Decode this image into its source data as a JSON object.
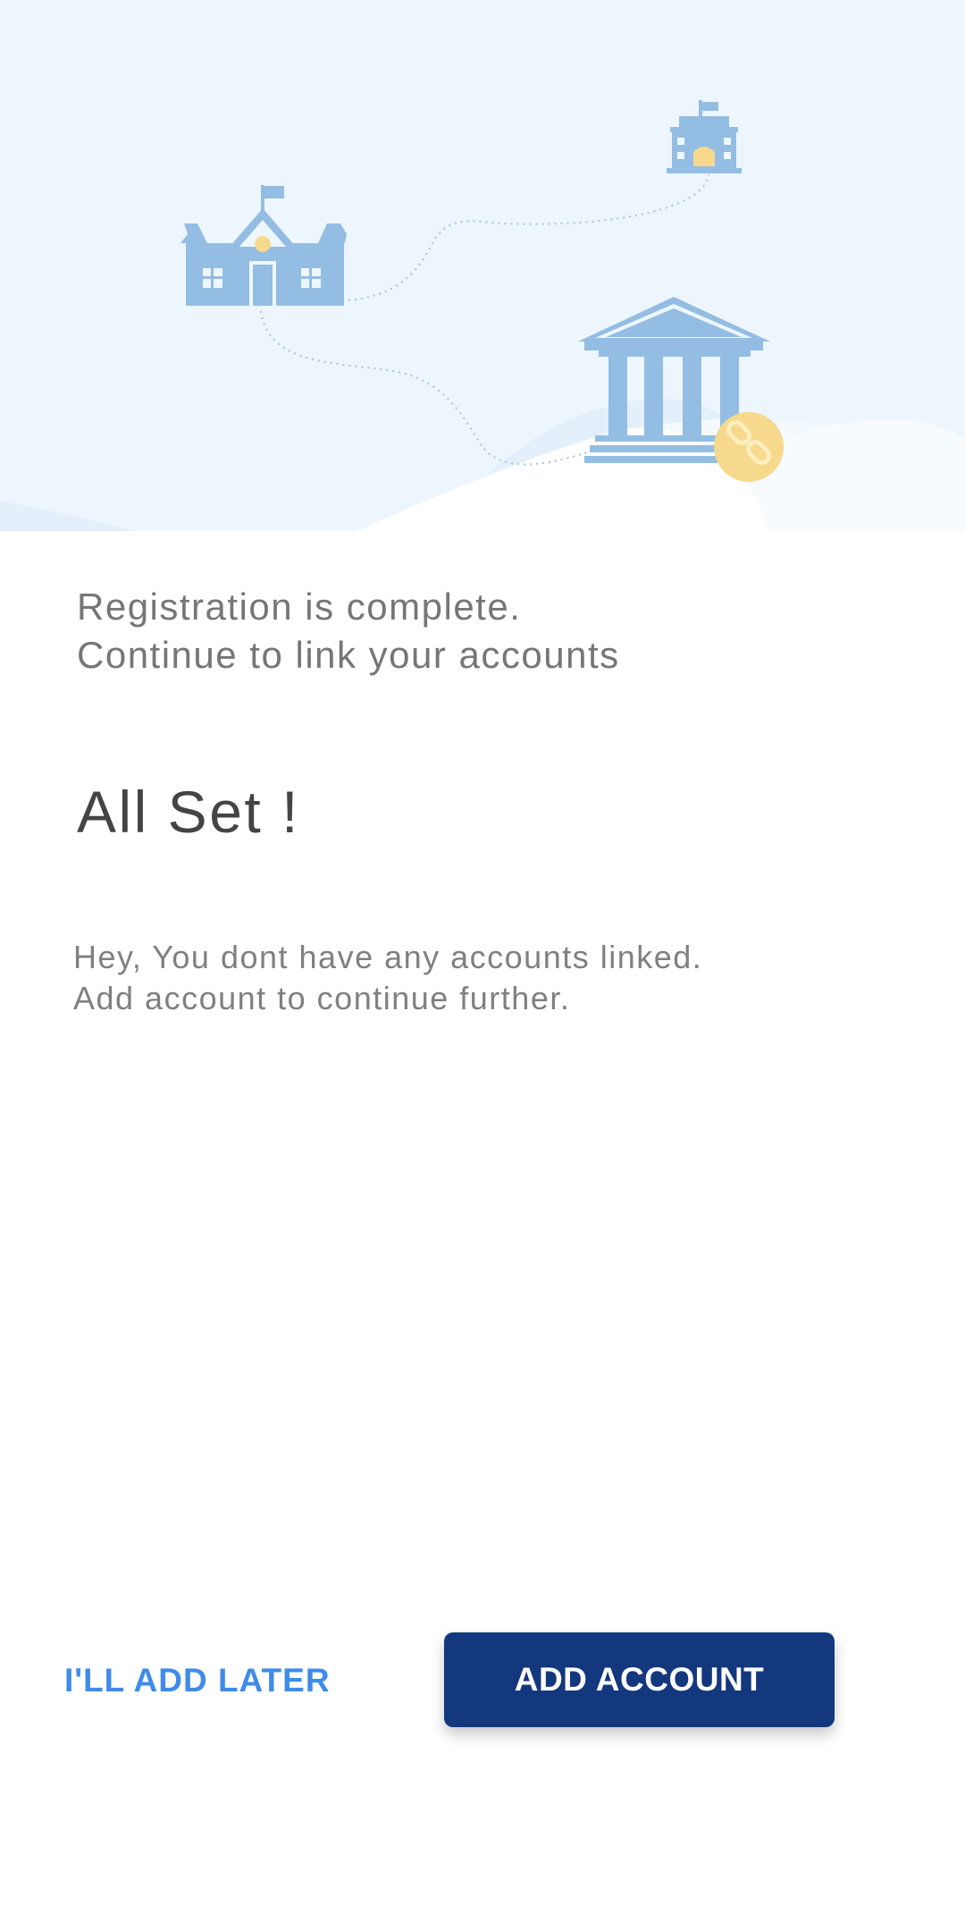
{
  "colors": {
    "hero_background": "#edf6fd",
    "illustration_blue": "#93bde3",
    "illustration_accent": "#f6d98c",
    "primary_button": "#13387d",
    "link_button": "#3f8be8"
  },
  "hero": {
    "icons": [
      "school-icon",
      "office-building-icon",
      "bank-icon",
      "link-badge-icon"
    ]
  },
  "registration": {
    "subtitle_line1": "Registration is complete.",
    "subtitle_line2": "Continue to link your accounts",
    "title": "All Set !",
    "message_line1": "Hey, You dont have any accounts linked.",
    "message_line2": "Add account to continue further."
  },
  "actions": {
    "later_label": "I'LL ADD LATER",
    "add_label": "ADD ACCOUNT"
  }
}
